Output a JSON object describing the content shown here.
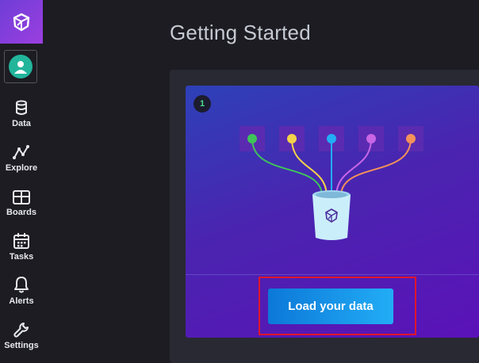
{
  "sidebar": {
    "logo_icon": "influxdb-cube-icon",
    "avatar_icon": "user-avatar-icon",
    "items": [
      {
        "label": "Data",
        "icon": "database-icon"
      },
      {
        "label": "Explore",
        "icon": "graph-line-icon"
      },
      {
        "label": "Boards",
        "icon": "dashboard-grid-icon"
      },
      {
        "label": "Tasks",
        "icon": "calendar-icon"
      },
      {
        "label": "Alerts",
        "icon": "bell-icon"
      },
      {
        "label": "Settings",
        "icon": "wrench-icon"
      }
    ]
  },
  "main": {
    "title": "Getting Started",
    "card": {
      "step_number": "1",
      "illustration": "data-sources-into-bucket-icon",
      "button_label": "Load your data"
    }
  },
  "colors": {
    "brand_purple": "#8b3fe0",
    "card_gradient_start": "#2d41b8",
    "card_gradient_end": "#5b12b8",
    "button_blue": "#1a9bef",
    "highlight_red": "#e0162b",
    "source_dots": [
      "#3fc35a",
      "#f4d24a",
      "#22adf6",
      "#c966e6",
      "#f4915a"
    ]
  }
}
